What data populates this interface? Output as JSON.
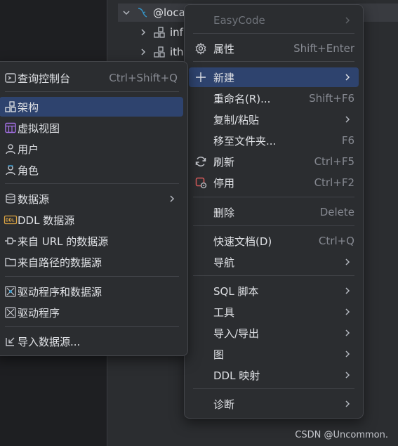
{
  "tree": {
    "root_label": "@loca",
    "children": [
      {
        "label": "inf"
      },
      {
        "label": "ith"
      }
    ]
  },
  "menu_main": {
    "items": [
      {
        "label": "EasyCode",
        "disabled": true,
        "submenu": true
      },
      {
        "label": "属性",
        "shortcut": "Shift+Enter",
        "icon": "gear-icon"
      },
      {
        "label": "新建",
        "submenu": true,
        "highlighted": true,
        "icon": "plus-icon"
      },
      {
        "label": "重命名(R)...",
        "shortcut": "Shift+F6"
      },
      {
        "label": "复制/粘贴",
        "submenu": true
      },
      {
        "label": "移至文件夹...",
        "shortcut": "F6"
      },
      {
        "label": "刷新",
        "shortcut": "Ctrl+F5",
        "icon": "refresh-icon"
      },
      {
        "label": "停用",
        "shortcut": "Ctrl+F2",
        "icon": "disconnect-icon"
      },
      {
        "label": "删除",
        "shortcut": "Delete"
      },
      {
        "label": "快速文档(D)",
        "shortcut": "Ctrl+Q"
      },
      {
        "label": "导航",
        "submenu": true
      },
      {
        "label": "SQL 脚本",
        "submenu": true
      },
      {
        "label": "工具",
        "submenu": true
      },
      {
        "label": "导入/导出",
        "submenu": true
      },
      {
        "label": "图",
        "submenu": true
      },
      {
        "label": "DDL 映射",
        "submenu": true
      },
      {
        "label": "诊断",
        "submenu": true
      }
    ]
  },
  "menu_new": {
    "items": [
      {
        "label": "查询控制台",
        "shortcut": "Ctrl+Shift+Q",
        "icon": "console-icon"
      },
      {
        "label": "架构",
        "highlighted": true,
        "icon": "schema-icon"
      },
      {
        "label": "虚拟视图",
        "icon": "virtual-view-icon"
      },
      {
        "label": "用户",
        "icon": "user-icon"
      },
      {
        "label": "角色",
        "icon": "role-icon"
      },
      {
        "label": "数据源",
        "submenu": true,
        "icon": "datasource-icon"
      },
      {
        "label": "DDL 数据源",
        "icon": "ddl-icon"
      },
      {
        "label": "来自 URL 的数据源",
        "icon": "url-plug-icon"
      },
      {
        "label": "来自路径的数据源",
        "icon": "folder-icon"
      },
      {
        "label": "驱动程序和数据源",
        "icon": "driver-datasource-icon"
      },
      {
        "label": "驱动程序",
        "icon": "driver-icon"
      },
      {
        "label": "导入数据源...",
        "icon": "import-icon"
      }
    ]
  },
  "watermark": "CSDN @Uncommon.",
  "colors": {
    "menu_bg": "#2b2d30",
    "highlight": "#2e436e",
    "text": "#dfe1e5",
    "shortcut": "#868991",
    "accent_blue": "#3592c4",
    "error_red": "#db5c5c",
    "ddl_yellow": "#d9a343",
    "virtual_purple": "#a571e6"
  }
}
